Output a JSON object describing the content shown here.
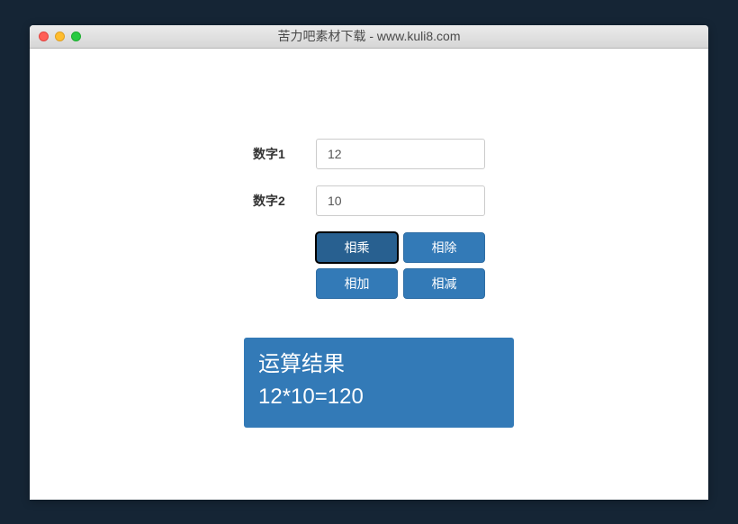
{
  "window": {
    "title": "苦力吧素材下载 - www.kuli8.com"
  },
  "form": {
    "label1": "数字1",
    "label2": "数字2",
    "value1": "12",
    "value2": "10"
  },
  "buttons": {
    "multiply": "相乘",
    "divide": "相除",
    "add": "相加",
    "subtract": "相减"
  },
  "result": {
    "title": "运算结果",
    "value": "12*10=120"
  }
}
